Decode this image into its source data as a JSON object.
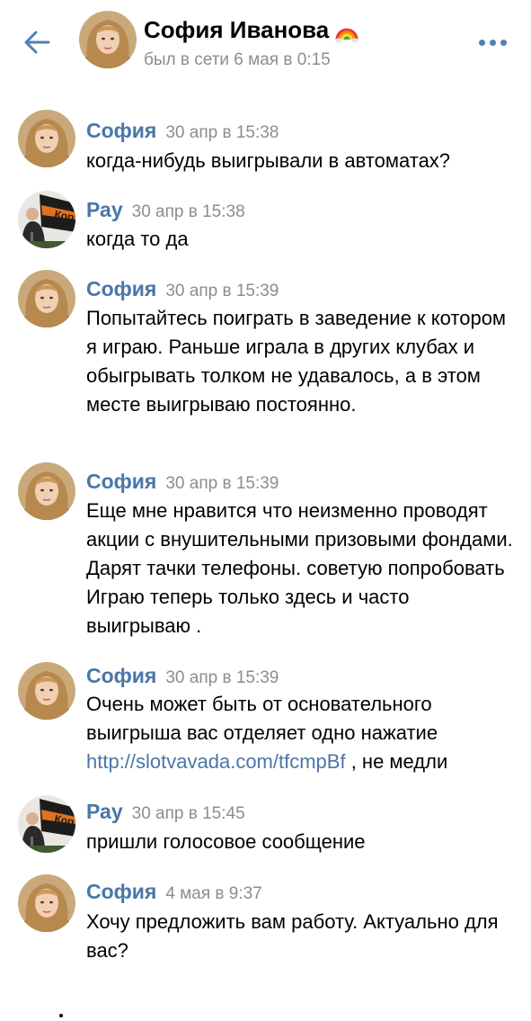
{
  "header": {
    "back_icon": "arrow-left-icon",
    "name": "София Иванова",
    "status": "был в сети 6 мая в 0:15",
    "more_icon": "ellipsis-icon",
    "accent": "#5181b8"
  },
  "messages": [
    {
      "author": "София",
      "time": "30 апр в 15:38",
      "text": "когда-нибудь выигрывали в автоматах?"
    },
    {
      "author": "Рау",
      "time": "30 апр в 15:38",
      "text": "когда то да"
    },
    {
      "author": "София",
      "time": "30 апр в 15:39",
      "text": "Попытайтесь поиграть в заведение к котором я играю. Раньше играла в других клубах и обыгрывать толком не удавалось, а в этом месте выигрываю постоянно."
    },
    {
      "author": "София",
      "time": "30 апр в 15:39",
      "text": "Еще мне нравится что неизменно проводят акции с внушительными призовыми фондами. Дарят тачки телефоны. советую попробовать Играю теперь только здесь и часто выигрываю ."
    },
    {
      "author": "София",
      "time": "30 апр в 15:39",
      "text_before": "Очень может быть от основательного выигрыша вас отделяет одно нажатие",
      "link": "http://slotvavada.com/tfcmpBf",
      "text_after": ", не медли"
    },
    {
      "author": "Рау",
      "time": "30 апр в 15:45",
      "text": "пришли голосовое сообщение"
    },
    {
      "author": "София",
      "time": "4 мая в 9:37",
      "text": "Хочу предложить вам работу. Актуально для вас?"
    }
  ]
}
